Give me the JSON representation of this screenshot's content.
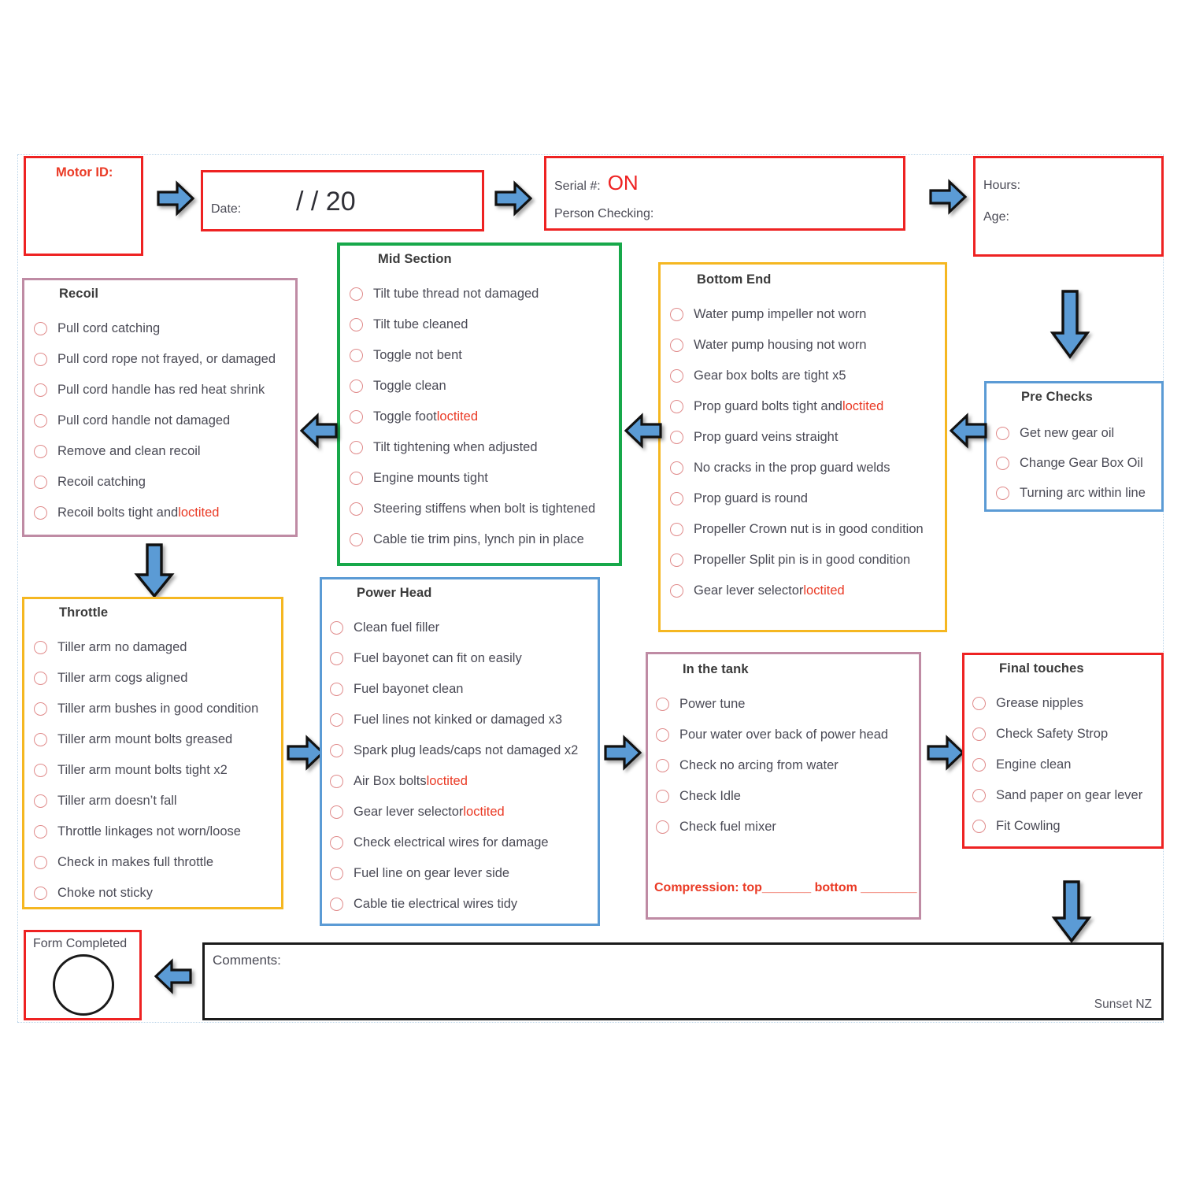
{
  "header": {
    "motor_id_label": "Motor ID:",
    "date_label": "Date:",
    "date_value": "/        / 20",
    "serial_label": "Serial #:",
    "serial_value": "ON",
    "person_checking_label": "Person Checking:",
    "hours_label": "Hours:",
    "age_label": "Age:"
  },
  "sections": {
    "recoil": {
      "title": "Recoil",
      "items": [
        {
          "text": "Pull cord catching"
        },
        {
          "text": "Pull cord rope not frayed, or damaged"
        },
        {
          "text": "Pull cord handle has red heat shrink"
        },
        {
          "text": "Pull cord handle not damaged"
        },
        {
          "text": "Remove and clean recoil"
        },
        {
          "text": "Recoil catching"
        },
        {
          "text": "Recoil bolts tight and ",
          "red": "loctited"
        }
      ]
    },
    "mid_section": {
      "title": "Mid Section",
      "items": [
        {
          "text": "Tilt tube thread not damaged"
        },
        {
          "text": "Tilt tube cleaned"
        },
        {
          "text": "Toggle not bent"
        },
        {
          "text": "Toggle clean"
        },
        {
          "text": "Toggle foot ",
          "red": "loctited"
        },
        {
          "text": "Tilt tightening when adjusted"
        },
        {
          "text": "Engine mounts tight"
        },
        {
          "text": "Steering stiffens when bolt is tightened"
        },
        {
          "text": "Cable tie trim pins, lynch pin in place"
        }
      ]
    },
    "bottom_end": {
      "title": "Bottom End",
      "items": [
        {
          "text": "Water pump impeller not worn"
        },
        {
          "text": "Water pump housing not worn"
        },
        {
          "text": "Gear box bolts are tight x5"
        },
        {
          "text": "Prop guard bolts tight and ",
          "red": "loctited"
        },
        {
          "text": "Prop guard veins straight"
        },
        {
          "text": "No cracks in the prop guard welds"
        },
        {
          "text": "Prop guard is round"
        },
        {
          "text": "Propeller Crown nut is in good condition"
        },
        {
          "text": "Propeller Split pin is in good condition"
        },
        {
          "text": "Gear lever selector ",
          "red": "loctited"
        }
      ]
    },
    "pre_checks": {
      "title": "Pre Checks",
      "items": [
        {
          "text": "Get new gear oil"
        },
        {
          "text": "Change Gear Box Oil"
        },
        {
          "text": "Turning arc within line"
        }
      ]
    },
    "throttle": {
      "title": "Throttle",
      "items": [
        {
          "text": "Tiller arm no damaged"
        },
        {
          "text": "Tiller arm cogs aligned"
        },
        {
          "text": "Tiller arm bushes in good condition"
        },
        {
          "text": "Tiller arm mount bolts greased"
        },
        {
          "text": "Tiller arm mount bolts tight x2"
        },
        {
          "text": "Tiller arm doesn’t fall"
        },
        {
          "text": "Throttle linkages not worn/loose"
        },
        {
          "text": "Check in makes full throttle"
        },
        {
          "text": "Choke not sticky"
        }
      ]
    },
    "power_head": {
      "title": "Power Head",
      "items": [
        {
          "text": "Clean fuel filler"
        },
        {
          "text": "Fuel bayonet can fit on easily"
        },
        {
          "text": "Fuel bayonet clean"
        },
        {
          "text": "Fuel lines not kinked or damaged x3"
        },
        {
          "text": "Spark plug leads/caps not damaged x2"
        },
        {
          "text": "Air Box bolts ",
          "red": "loctited"
        },
        {
          "text": "Gear lever selector ",
          "red": "loctited"
        },
        {
          "text": "Check electrical wires for damage"
        },
        {
          "text": "Fuel line on gear lever side"
        },
        {
          "text": "Cable tie electrical wires tidy"
        }
      ]
    },
    "in_the_tank": {
      "title": "In the tank",
      "items": [
        {
          "text": "Power tune"
        },
        {
          "text": "Pour water over back of power head"
        },
        {
          "text": "Check no arcing from water"
        },
        {
          "text": "Check Idle"
        },
        {
          "text": "Check fuel mixer"
        }
      ],
      "compression": "Compression: top_______  bottom ________"
    },
    "final_touches": {
      "title": "Final touches",
      "items": [
        {
          "text": "Grease nipples"
        },
        {
          "text": "Check Safety Strop"
        },
        {
          "text": "Engine clean"
        },
        {
          "text": "Sand paper on gear lever"
        },
        {
          "text": "Fit Cowling"
        }
      ]
    }
  },
  "footer": {
    "form_completed_label": "Form Completed",
    "comments_label": "Comments:",
    "credit": "Sunset NZ"
  },
  "colors": {
    "red": "#ee2222",
    "green": "#17a84a",
    "gold": "#f5b721",
    "mauve": "#bf8ba4",
    "blue": "#5b9bd5",
    "black": "#111111",
    "arrow_fill": "#5b9bd5",
    "arrow_stroke": "#111111",
    "checkbox": "#e08b8b",
    "accent_red_text": "#ea3a25"
  }
}
